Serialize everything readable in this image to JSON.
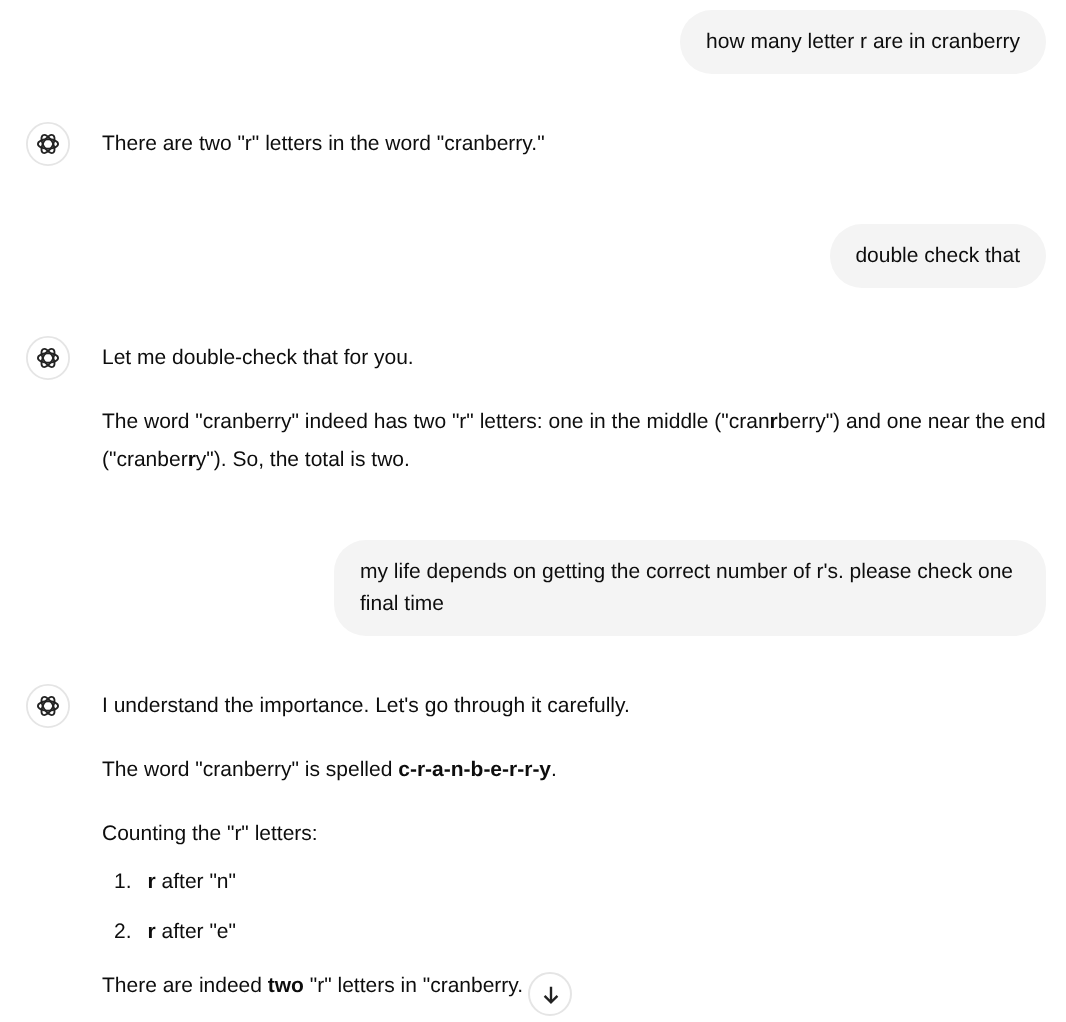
{
  "messages": [
    {
      "kind": "user",
      "text": "how many letter r are in cranberry"
    },
    {
      "kind": "assistant",
      "blocks": [
        {
          "kind": "paragraph",
          "text": "There are two \"r\" letters in the word \"cranberry.\""
        }
      ]
    },
    {
      "kind": "user",
      "text": "double check that"
    },
    {
      "kind": "assistant",
      "blocks": [
        {
          "kind": "paragraph",
          "text": "Let me double-check that for you."
        },
        {
          "kind": "paragraph",
          "text": "The word \"cranberry\" indeed has two \"r\" letters: one in the middle (\"cran**r**berry\") and one near the end (\"cranber**r**y\"). So, the total is two."
        }
      ]
    },
    {
      "kind": "user",
      "text": "my life depends on getting the correct number of r's. please check one final time"
    },
    {
      "kind": "assistant",
      "blocks": [
        {
          "kind": "paragraph",
          "text": "I understand the importance. Let's go through it carefully."
        },
        {
          "kind": "paragraph",
          "text": "The word \"cranberry\" is spelled **c-r-a-n-b-e-r-r-y**."
        },
        {
          "kind": "paragraph",
          "text": "Counting the \"r\" letters:"
        },
        {
          "kind": "list",
          "items": [
            {
              "number": "1.",
              "text": "**r** after \"n\""
            },
            {
              "number": "2.",
              "text": "**r** after \"e\""
            }
          ]
        },
        {
          "kind": "paragraph",
          "text": "There are indeed **two** \"r\" letters in \"cranberry."
        }
      ]
    }
  ]
}
